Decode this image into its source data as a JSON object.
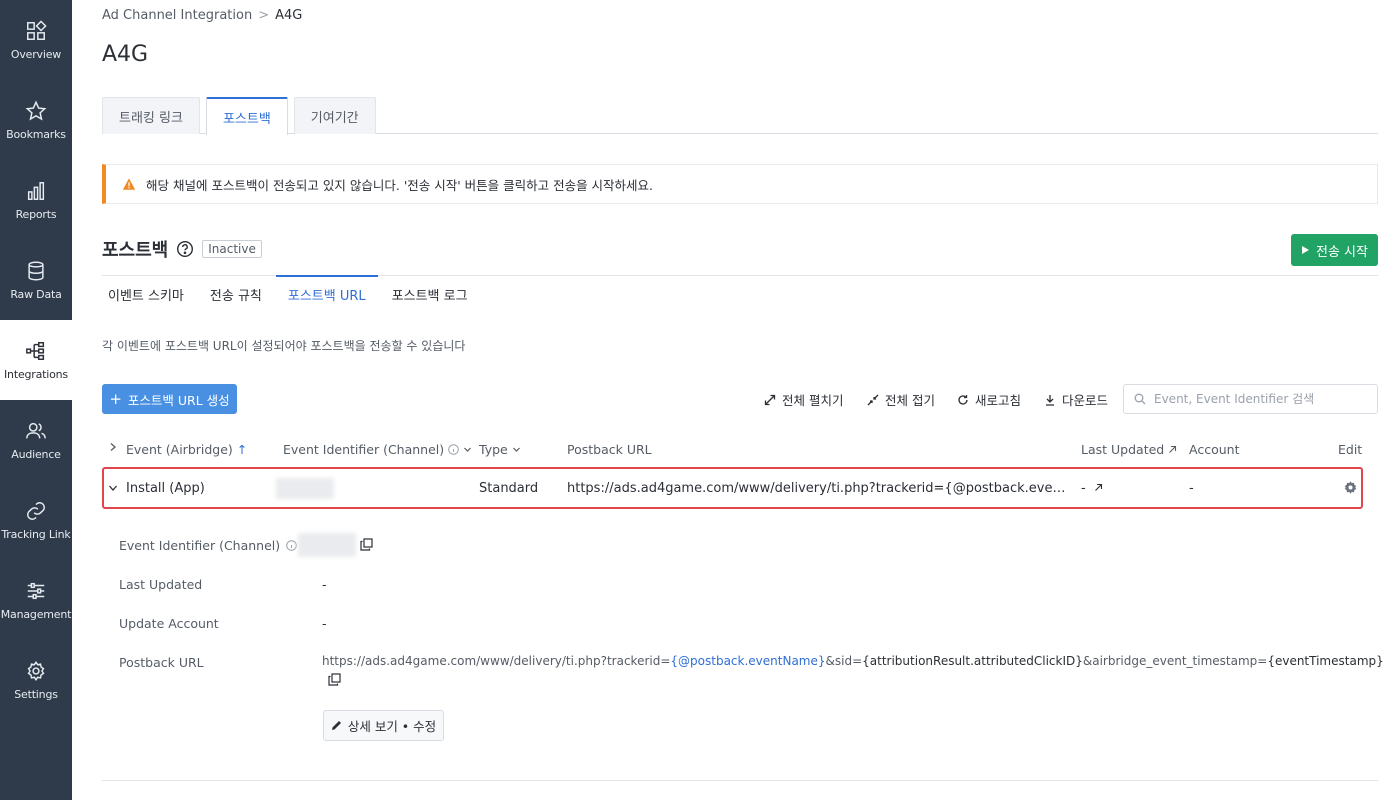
{
  "sidebar": {
    "items": [
      {
        "label": "Overview",
        "icon": "overview-icon"
      },
      {
        "label": "Bookmarks",
        "icon": "star-icon"
      },
      {
        "label": "Reports",
        "icon": "bar-chart-icon"
      },
      {
        "label": "Raw Data",
        "icon": "database-icon"
      },
      {
        "label": "Integrations",
        "icon": "integrations-icon",
        "active": true
      },
      {
        "label": "Audience",
        "icon": "users-icon"
      },
      {
        "label": "Tracking Link",
        "icon": "link-icon"
      },
      {
        "label": "Management",
        "icon": "sliders-icon"
      },
      {
        "label": "Settings",
        "icon": "gear-icon"
      }
    ]
  },
  "breadcrumb": {
    "parent": "Ad Channel Integration",
    "separator": ">",
    "current": "A4G"
  },
  "page_title": "A4G",
  "tabs": [
    {
      "label": "트래킹 링크"
    },
    {
      "label": "포스트백",
      "active": true
    },
    {
      "label": "기여기간"
    }
  ],
  "alert": {
    "text": "해당 채널에 포스트백이 전송되고 있지 않습니다. '전송 시작' 버튼을 클릭하고 전송을 시작하세요.",
    "color": "#f08a24"
  },
  "section": {
    "title": "포스트백",
    "status": "Inactive"
  },
  "start_button": {
    "label": "전송 시작",
    "color": "#21a366"
  },
  "subtabs": [
    {
      "label": "이벤트 스키마"
    },
    {
      "label": "전송 규칙"
    },
    {
      "label": "포스트백 URL",
      "active": true
    },
    {
      "label": "포스트백 로그"
    }
  ],
  "description": "각 이벤트에 포스트백 URL이 설정되어야 포스트백을 전송할 수 있습니다",
  "create_button": {
    "label": "포스트백 URL 생성"
  },
  "toolbar": {
    "expand_all": "전체 펼치기",
    "collapse_all": "전체 접기",
    "refresh": "새로고침",
    "download": "다운로드"
  },
  "search": {
    "placeholder": "Event, Event Identifier 검색"
  },
  "table": {
    "headers": {
      "event": "Event (Airbridge)",
      "event_sort": "↑",
      "identifier": "Event Identifier (Channel)",
      "type": "Type",
      "postback_url": "Postback URL",
      "last_updated": "Last Updated",
      "account": "Account",
      "edit": "Edit"
    },
    "row": {
      "event": "Install (App)",
      "type": "Standard",
      "postback_url": "https://ads.ad4game.com/www/delivery/ti.php?trackerid={@postback.eventName}&si...",
      "last_updated": "-",
      "account": "-"
    }
  },
  "detail": {
    "identifier_label": "Event Identifier (Channel)",
    "last_updated_label": "Last Updated",
    "last_updated_value": "-",
    "update_account_label": "Update Account",
    "update_account_value": "-",
    "postback_url_label": "Postback URL",
    "url_parts": {
      "p1": "https://ads.ad4game.com/www/delivery/ti.php?trackerid=",
      "p2": "{@postback.eventName}",
      "p3": "&sid=",
      "p4": "{attributionResult.attributedClickID}",
      "p5": "&airbridge_event_timestamp=",
      "p6": "{eventTimestamp}"
    },
    "edit_button": "상세 보기 • 수정"
  }
}
